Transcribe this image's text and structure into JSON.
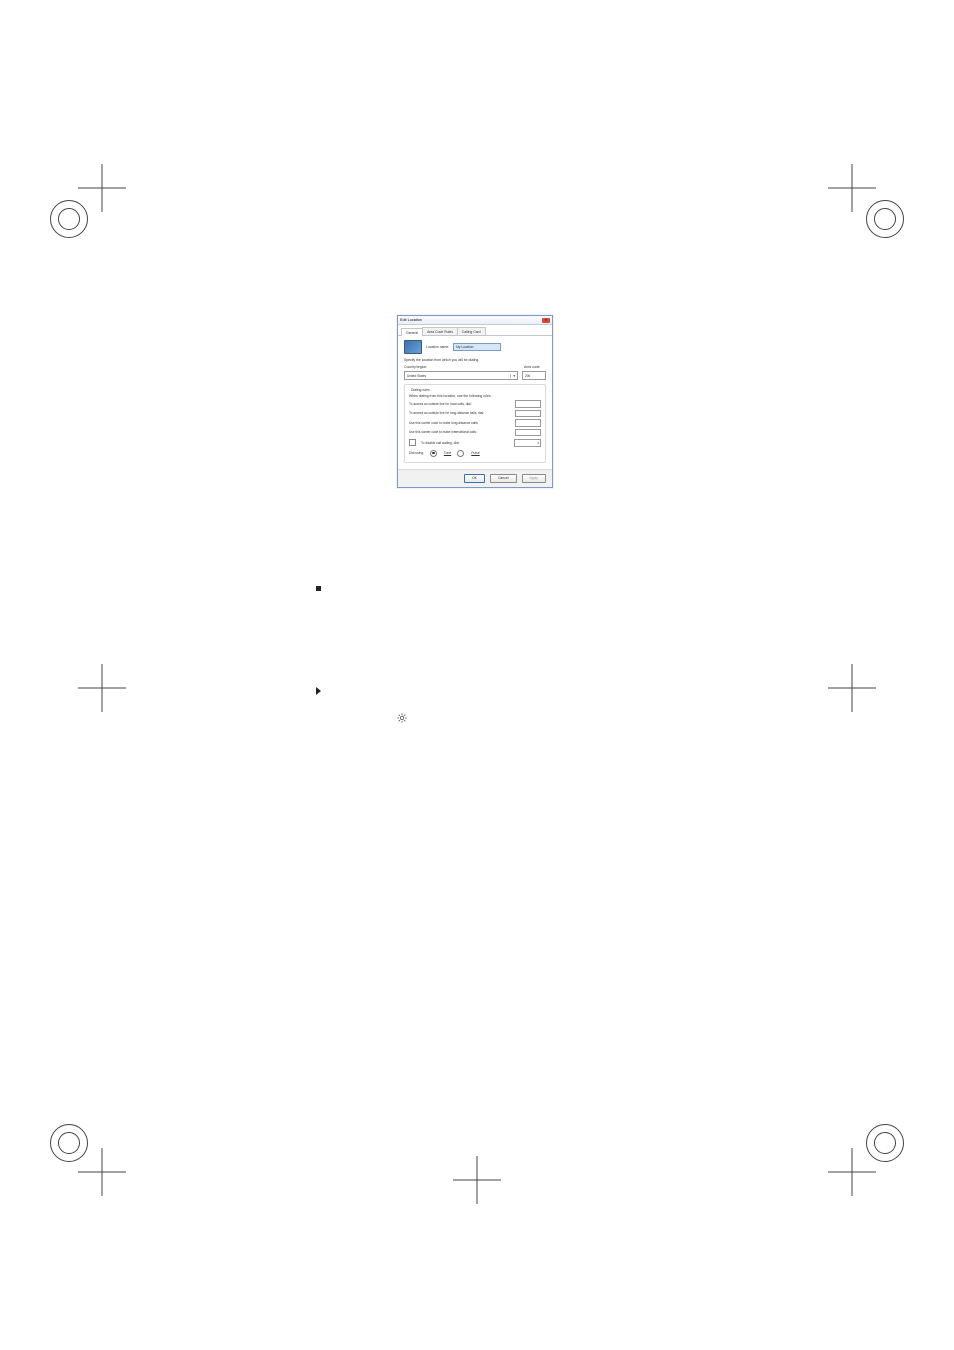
{
  "dialog": {
    "title": "Edit Location",
    "close_tip": "×",
    "tabs": {
      "general": "General",
      "areacode": "Area Code Rules",
      "callingcard": "Calling Card"
    },
    "location_name_label": "Location name:",
    "location_name_value": "My Location",
    "specify_text": "Specify the location from which you will be dialing.",
    "country_label": "Country/region:",
    "country_value": "United States",
    "area_label": "Area code:",
    "area_value": "206",
    "rules_title": "Dialing rules",
    "rules_note": "When dialing from this location, use the following rules:",
    "line_local": "To access an outside line for local calls, dial:",
    "line_long": "To access an outside line for long-distance calls, dial:",
    "line_carrier_long": "Use this carrier code to make long-distance calls:",
    "line_carrier_intl": "Use this carrier code to make international calls:",
    "disable_cw": "To disable call waiting, dial:",
    "dial_using": "Dial using:",
    "tone": "Tone",
    "pulse": "Pulse",
    "ok": "OK",
    "cancel": "Cancel",
    "apply": "Apply"
  },
  "page_text": {
    "bullet1": "",
    "bullet2": ""
  }
}
